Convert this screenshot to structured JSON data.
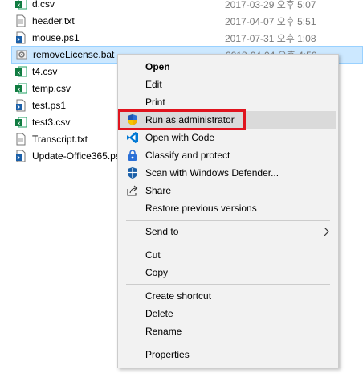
{
  "files": [
    {
      "name": "d.csv",
      "date": "2017-03-29 오후 5:07",
      "icon": "excel-csv-icon"
    },
    {
      "name": "header.txt",
      "date": "2017-04-07 오후 5:51",
      "icon": "text-file-icon"
    },
    {
      "name": "mouse.ps1",
      "date": "2017-07-31 오후 1:08",
      "icon": "powershell-script-icon"
    },
    {
      "name": "removeLicense.bat",
      "date": "2018-04-04 오후 4:50",
      "icon": "batch-file-icon"
    },
    {
      "name": "t4.csv",
      "date": "",
      "icon": "excel-csv-icon"
    },
    {
      "name": "temp.csv",
      "date": "",
      "icon": "excel-csv-icon"
    },
    {
      "name": "test.ps1",
      "date": "",
      "icon": "powershell-script-icon"
    },
    {
      "name": "test3.csv",
      "date": "",
      "icon": "excel-csv-icon"
    },
    {
      "name": "Transcript.txt",
      "date": "",
      "icon": "text-file-icon"
    },
    {
      "name": "Update-Office365.ps",
      "date": "",
      "icon": "powershell-script-icon"
    }
  ],
  "context_menu": {
    "open": "Open",
    "edit": "Edit",
    "print": "Print",
    "run_as_admin": "Run as administrator",
    "open_with_code": "Open with Code",
    "classify_protect": "Classify and protect",
    "scan_defender": "Scan with Windows Defender...",
    "share": "Share",
    "restore_versions": "Restore previous versions",
    "send_to": "Send to",
    "cut": "Cut",
    "copy": "Copy",
    "create_shortcut": "Create shortcut",
    "delete": "Delete",
    "rename": "Rename",
    "properties": "Properties"
  },
  "colors": {
    "selection_bg": "#cce8ff",
    "hover_bg": "#dadada",
    "highlight_border": "#e0141e"
  }
}
